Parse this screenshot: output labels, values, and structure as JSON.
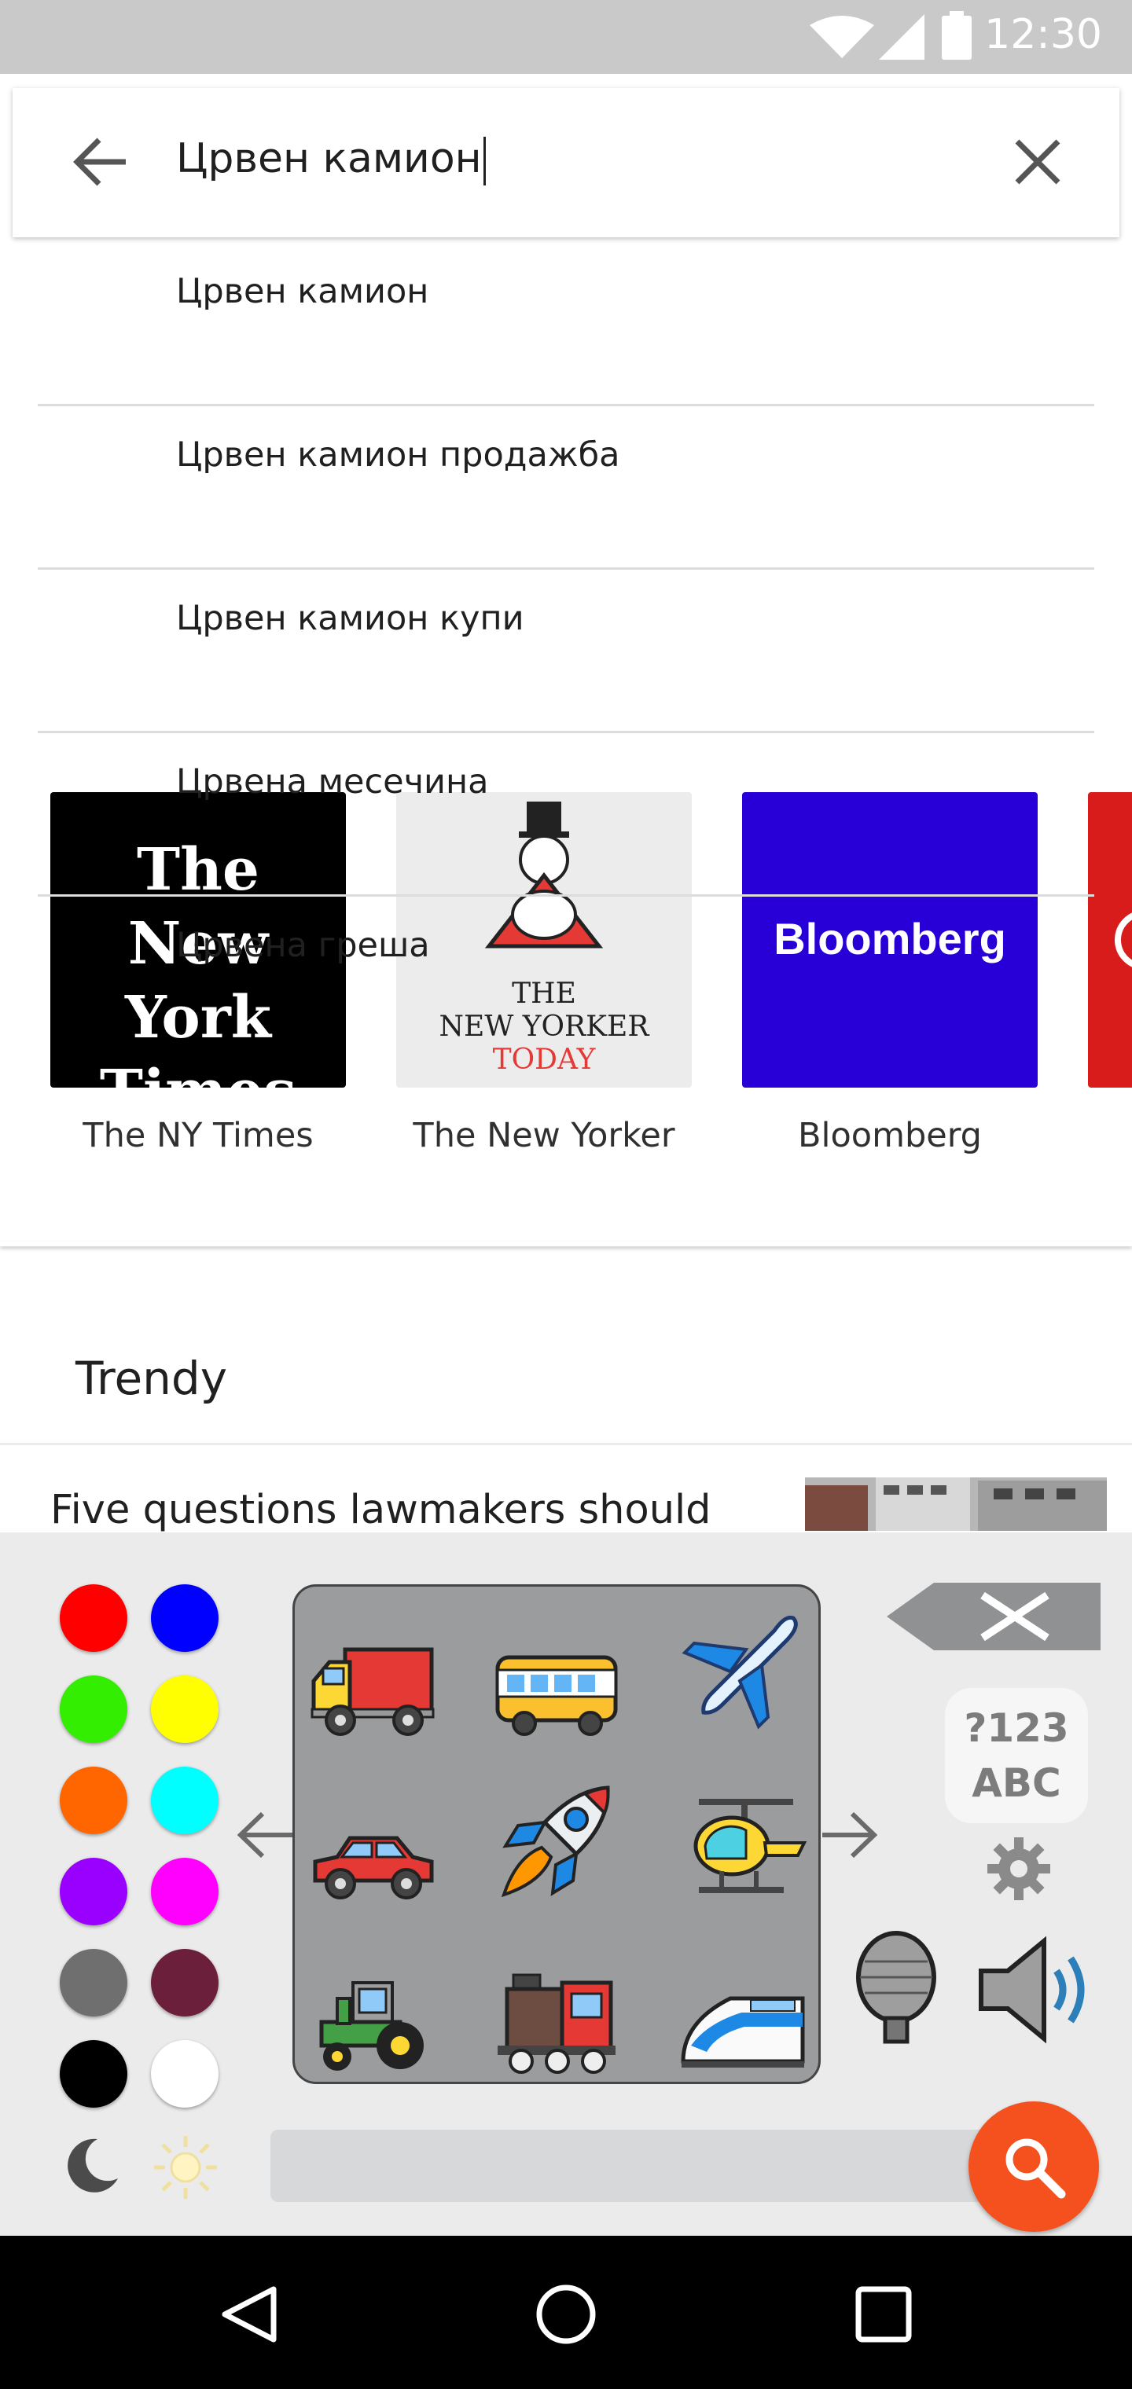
{
  "status_bar": {
    "time": "12:30",
    "icons": [
      "wifi-icon",
      "signal-icon",
      "battery-icon"
    ]
  },
  "search": {
    "query": "Црвен камион",
    "icons": [
      "back-arrow-icon",
      "clear-icon"
    ]
  },
  "suggestions": [
    {
      "label": "Црвен камион"
    },
    {
      "label": "Црвен камион продажба"
    },
    {
      "label": "Црвен камион купи"
    },
    {
      "label": "Црвена месечина"
    },
    {
      "label": "Црвена греша"
    }
  ],
  "news_sources": [
    {
      "label": "The NY Times",
      "logo_lines": [
        "The",
        "New York",
        "Times"
      ],
      "bg": "#000000"
    },
    {
      "label": "The New Yorker",
      "logo_lines": [
        "THE",
        "NEW YORKER",
        "TODAY"
      ],
      "bg": "#ececec"
    },
    {
      "label": "Bloomberg",
      "logo_lines": [
        "Bloomberg"
      ],
      "bg": "#2800d7"
    }
  ],
  "trendy": {
    "heading": "Trendy",
    "article_title": "Five questions lawmakers should"
  },
  "keyboard": {
    "colors": [
      "#ff0000",
      "#0000ff",
      "#33ee00",
      "#ffff00",
      "#ff6600",
      "#00ffff",
      "#9900ff",
      "#ff00ff",
      "#6f6f6f",
      "#6b1f3a",
      "#000000",
      "#ffffff"
    ],
    "emoji": [
      "delivery-truck-icon",
      "bus-icon",
      "airplane-icon",
      "car-icon",
      "rocket-icon",
      "helicopter-icon",
      "tractor-icon",
      "locomotive-icon",
      "bullet-train-icon"
    ],
    "mode_key_top": "?123",
    "mode_key_bottom": "ABC",
    "accent": "#f4511e"
  },
  "nav_bar": {
    "icons": [
      "back-triangle-icon",
      "home-circle-icon",
      "recents-square-icon"
    ]
  }
}
